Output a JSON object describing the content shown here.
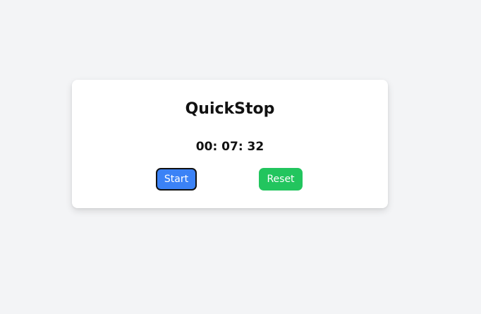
{
  "app": {
    "title": "QuickStop"
  },
  "timer": {
    "display": "00: 07: 32"
  },
  "controls": {
    "start_label": "Start",
    "reset_label": "Reset"
  },
  "colors": {
    "background": "#f3f4f6",
    "card": "#ffffff",
    "start_button": "#3b82f6",
    "reset_button": "#22c55e"
  }
}
